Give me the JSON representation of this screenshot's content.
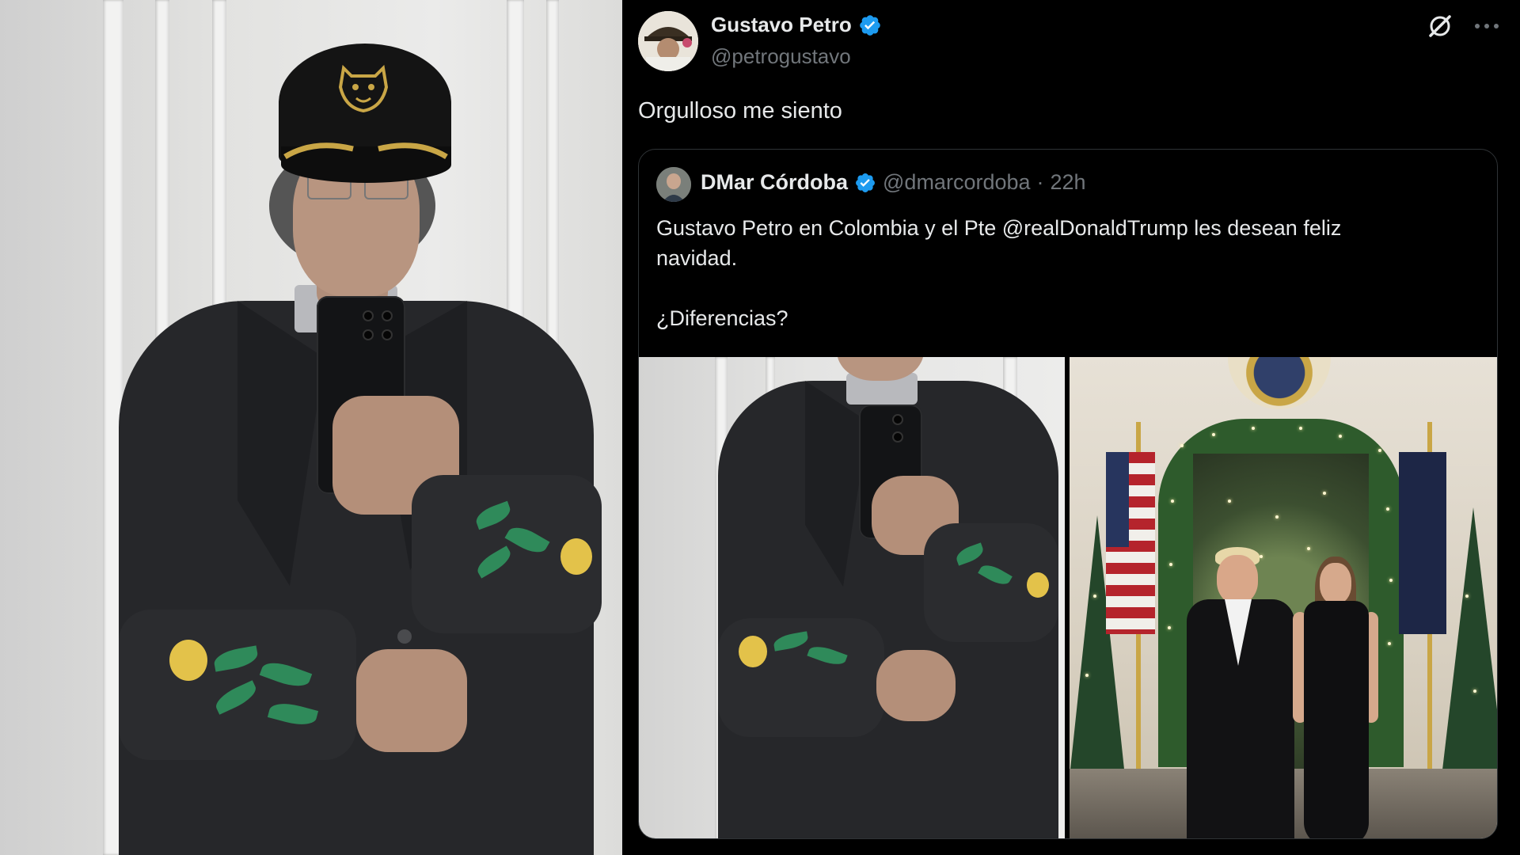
{
  "author": {
    "display_name": "Gustavo Petro",
    "handle": "@petrogustavo"
  },
  "tweet": {
    "text": "Orgulloso me siento"
  },
  "quoted_tweet": {
    "display_name": "DMar Córdoba",
    "handle": "@dmarcordoba",
    "separator": "·",
    "time": "22h",
    "text_line_1": "Gustavo Petro en Colombia y el Pte @realDonaldTrump les desean feliz",
    "text_line_2": "navidad.",
    "text_line_3": "¿Diferencias?"
  },
  "icons": {
    "verified": "verified-badge-icon",
    "grok": "grok-icon",
    "more": "more-options-icon"
  },
  "colors": {
    "background": "#000000",
    "text_primary": "#e7e9ea",
    "text_secondary": "#71767b",
    "verified_blue": "#1d9bf0",
    "border": "#2f3336"
  }
}
